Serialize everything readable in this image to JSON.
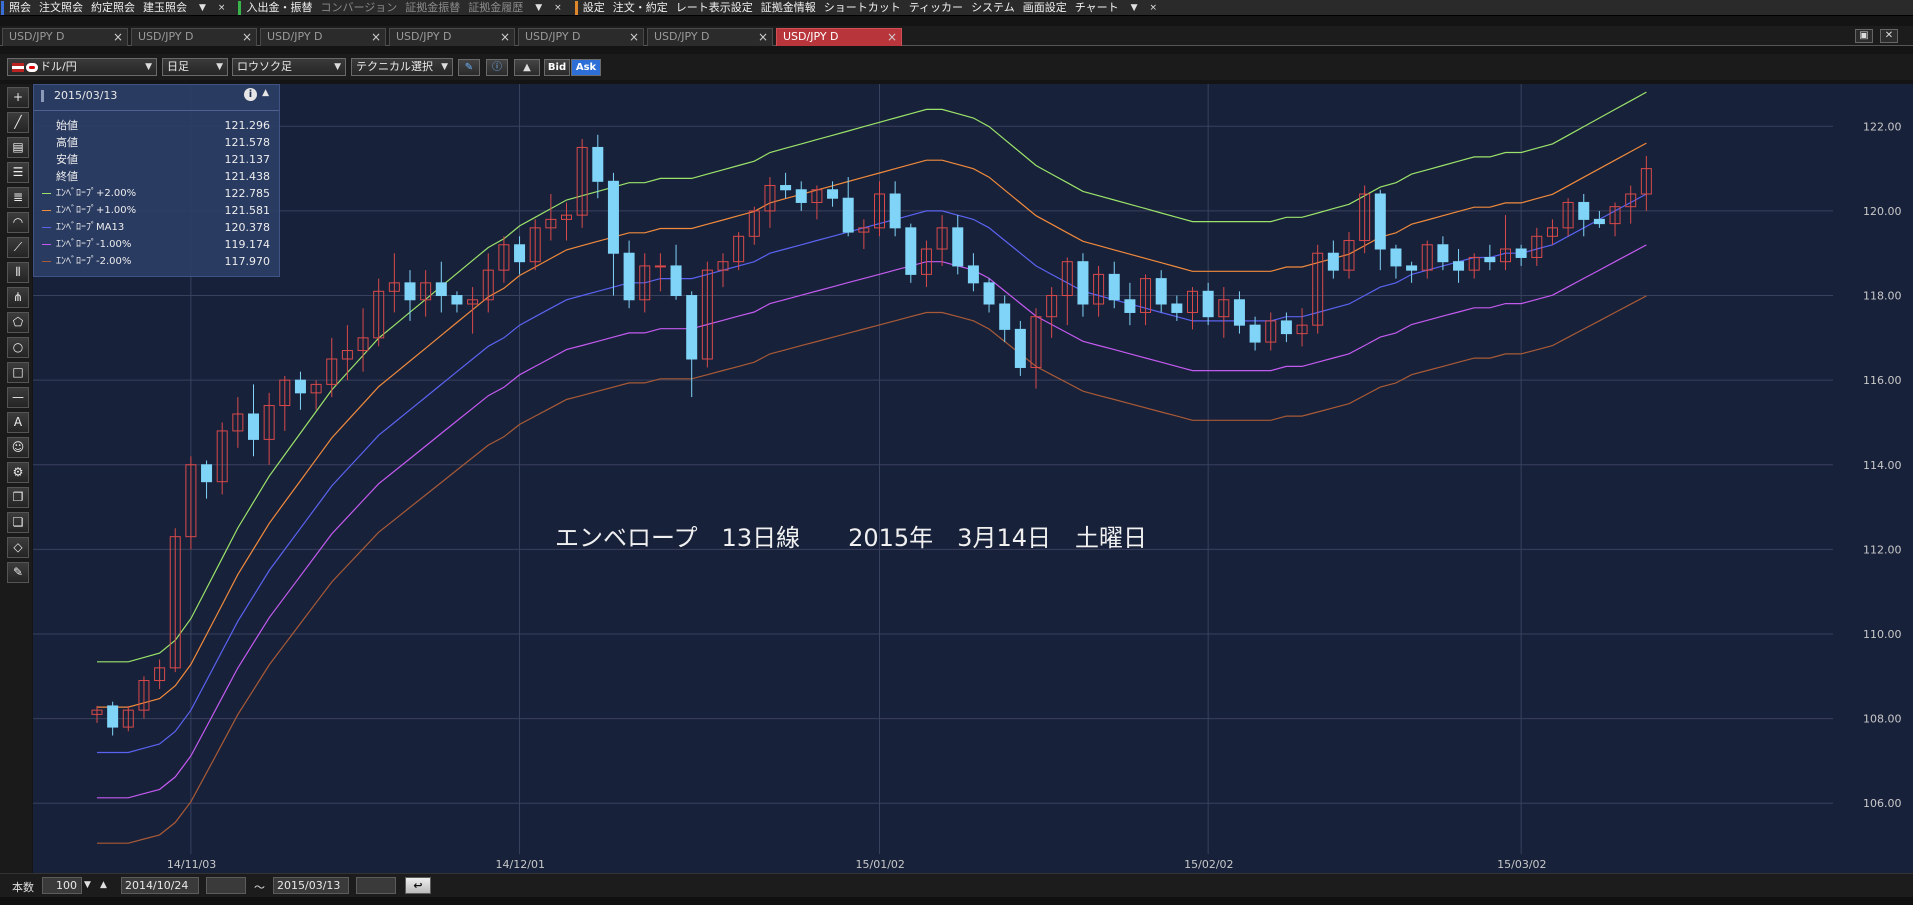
{
  "menubar": {
    "groups": [
      {
        "accent": "#3a6fd8",
        "items": [
          "照会",
          "注文照会",
          "約定照会",
          "建玉照会"
        ]
      },
      {
        "accent": "#38b44a",
        "items": [
          "入出金・振替",
          "コンバージョン",
          "証拠金振替",
          "証拠金履歴"
        ]
      },
      {
        "accent": "#e0862a",
        "items": [
          "設定",
          "注文・約定",
          "レート表示設定",
          "証拠金情報",
          "ショートカット",
          "ティッカー",
          "システム",
          "画面設定",
          "チャート"
        ]
      }
    ],
    "disabled_items": [
      "コンバージョン",
      "証拠金振替",
      "証拠金履歴"
    ],
    "dropdown_glyph": "▼",
    "close_glyph": "×"
  },
  "tabs": [
    {
      "label": "USD/JPY D",
      "active": false
    },
    {
      "label": "USD/JPY D",
      "active": false
    },
    {
      "label": "USD/JPY D",
      "active": false
    },
    {
      "label": "USD/JPY D",
      "active": false
    },
    {
      "label": "USD/JPY D",
      "active": false
    },
    {
      "label": "USD/JPY D",
      "active": false
    },
    {
      "label": "USD/JPY D",
      "active": true
    }
  ],
  "tab_close_glyph": "×",
  "window_controls": {
    "restore": "▣",
    "close": "✕"
  },
  "toolbar": {
    "currency_pair": "ドル/円",
    "timeframe": "日足",
    "chart_type": "ロウソク足",
    "technical_select": "テクニカル選択",
    "bid_label": "Bid",
    "ask_label": "Ask",
    "dropdown_arrow": "▼"
  },
  "info_panel": {
    "date": "2015/03/13",
    "info_glyph": "i",
    "collapse_glyph": "▲",
    "rows": [
      {
        "label": "始値",
        "value": "121.296",
        "color": ""
      },
      {
        "label": "高値",
        "value": "121.578",
        "color": ""
      },
      {
        "label": "安値",
        "value": "121.137",
        "color": ""
      },
      {
        "label": "終値",
        "value": "121.438",
        "color": ""
      },
      {
        "label": "ｴﾝﾍﾞﾛｰﾌﾟ+2.00%",
        "value": "122.785",
        "color": "#9be36a"
      },
      {
        "label": "ｴﾝﾍﾞﾛｰﾌﾟ+1.00%",
        "value": "121.581",
        "color": "#f08a3c"
      },
      {
        "label": "ｴﾝﾍﾞﾛｰﾌﾟMA13",
        "value": "120.378",
        "color": "#5a63f0"
      },
      {
        "label": "ｴﾝﾍﾞﾛｰﾌﾟ-1.00%",
        "value": "119.174",
        "color": "#c35af0"
      },
      {
        "label": "ｴﾝﾍﾞﾛｰﾌﾟ-2.00%",
        "value": "117.970",
        "color": "#a85a36"
      }
    ]
  },
  "chart_data": {
    "type": "line",
    "title": "エンベロープ　13日線　　2015年　3月14日　土曜日",
    "y_ticks": [
      106.0,
      108.0,
      110.0,
      112.0,
      114.0,
      116.0,
      118.0,
      120.0,
      122.0
    ],
    "ylim": [
      104.8,
      123.0
    ],
    "x_ticks": [
      "14/11/03",
      "14/12/01",
      "15/01/02",
      "15/02/02",
      "15/03/02"
    ],
    "x_tick_bar_index": [
      6,
      27,
      50,
      71,
      91
    ],
    "bar_count": 100,
    "candles_ohlc": [
      [
        108.1,
        108.3,
        107.9,
        108.2
      ],
      [
        108.3,
        108.4,
        107.6,
        107.8
      ],
      [
        107.8,
        108.3,
        107.7,
        108.2
      ],
      [
        108.2,
        109.0,
        108.0,
        108.9
      ],
      [
        108.9,
        109.4,
        108.7,
        109.2
      ],
      [
        109.2,
        112.5,
        109.1,
        112.3
      ],
      [
        112.3,
        114.2,
        112.0,
        114.0
      ],
      [
        114.0,
        114.1,
        113.2,
        113.6
      ],
      [
        113.6,
        115.0,
        113.3,
        114.8
      ],
      [
        114.8,
        115.6,
        114.4,
        115.2
      ],
      [
        115.2,
        115.9,
        114.2,
        114.6
      ],
      [
        114.6,
        115.7,
        114.0,
        115.4
      ],
      [
        115.4,
        116.1,
        114.8,
        116.0
      ],
      [
        116.0,
        116.2,
        115.3,
        115.7
      ],
      [
        115.7,
        116.0,
        115.3,
        115.9
      ],
      [
        115.9,
        117.0,
        115.6,
        116.5
      ],
      [
        116.5,
        117.3,
        116.0,
        116.7
      ],
      [
        116.7,
        117.7,
        116.2,
        117.0
      ],
      [
        117.0,
        118.4,
        116.8,
        118.1
      ],
      [
        118.1,
        119.0,
        117.6,
        118.3
      ],
      [
        118.3,
        118.6,
        117.4,
        117.9
      ],
      [
        117.9,
        118.6,
        117.5,
        118.3
      ],
      [
        118.3,
        118.8,
        117.6,
        118.0
      ],
      [
        118.0,
        118.1,
        117.6,
        117.8
      ],
      [
        117.8,
        118.2,
        117.1,
        117.9
      ],
      [
        117.9,
        119.0,
        117.6,
        118.6
      ],
      [
        118.6,
        119.4,
        118.3,
        119.2
      ],
      [
        119.2,
        119.4,
        118.5,
        118.8
      ],
      [
        118.8,
        119.8,
        118.6,
        119.6
      ],
      [
        119.6,
        120.4,
        119.3,
        119.8
      ],
      [
        119.8,
        120.2,
        119.3,
        119.9
      ],
      [
        119.9,
        121.7,
        119.6,
        121.5
      ],
      [
        121.5,
        121.8,
        120.3,
        120.7
      ],
      [
        120.7,
        120.9,
        118.0,
        119.0
      ],
      [
        119.0,
        119.3,
        117.7,
        117.9
      ],
      [
        117.9,
        119.0,
        117.6,
        118.7
      ],
      [
        118.7,
        119.0,
        118.1,
        118.7
      ],
      [
        118.7,
        119.2,
        117.9,
        118.0
      ],
      [
        118.0,
        118.1,
        115.6,
        116.5
      ],
      [
        116.5,
        118.8,
        116.3,
        118.6
      ],
      [
        118.6,
        119.0,
        118.2,
        118.8
      ],
      [
        118.8,
        119.5,
        118.6,
        119.4
      ],
      [
        119.4,
        120.1,
        119.2,
        120.0
      ],
      [
        120.0,
        120.8,
        119.6,
        120.6
      ],
      [
        120.6,
        120.9,
        120.3,
        120.5
      ],
      [
        120.5,
        120.7,
        120.0,
        120.2
      ],
      [
        120.2,
        120.6,
        119.8,
        120.5
      ],
      [
        120.5,
        120.7,
        120.1,
        120.3
      ],
      [
        120.3,
        120.8,
        119.4,
        119.5
      ],
      [
        119.5,
        119.8,
        119.1,
        119.6
      ],
      [
        119.6,
        120.7,
        119.4,
        120.4
      ],
      [
        120.4,
        120.7,
        119.4,
        119.6
      ],
      [
        119.6,
        119.7,
        118.3,
        118.5
      ],
      [
        118.5,
        119.3,
        118.2,
        119.1
      ],
      [
        119.1,
        119.9,
        118.7,
        119.6
      ],
      [
        119.6,
        119.9,
        118.5,
        118.7
      ],
      [
        118.7,
        119.0,
        118.1,
        118.3
      ],
      [
        118.3,
        118.4,
        117.6,
        117.8
      ],
      [
        117.8,
        118.0,
        116.9,
        117.2
      ],
      [
        117.2,
        117.4,
        116.1,
        116.3
      ],
      [
        116.3,
        117.7,
        115.8,
        117.5
      ],
      [
        117.5,
        118.2,
        117.0,
        118.0
      ],
      [
        118.0,
        118.9,
        117.3,
        118.8
      ],
      [
        118.8,
        119.0,
        117.5,
        117.8
      ],
      [
        117.8,
        118.7,
        117.5,
        118.5
      ],
      [
        118.5,
        118.8,
        117.7,
        117.9
      ],
      [
        117.9,
        118.3,
        117.3,
        117.6
      ],
      [
        117.6,
        118.5,
        117.3,
        118.4
      ],
      [
        118.4,
        118.6,
        117.6,
        117.8
      ],
      [
        117.8,
        118.0,
        117.4,
        117.6
      ],
      [
        117.6,
        118.2,
        117.2,
        118.1
      ],
      [
        118.1,
        118.3,
        117.3,
        117.5
      ],
      [
        117.5,
        118.2,
        117.0,
        117.9
      ],
      [
        117.9,
        118.1,
        117.1,
        117.3
      ],
      [
        117.3,
        117.5,
        116.7,
        116.9
      ],
      [
        116.9,
        117.6,
        116.7,
        117.4
      ],
      [
        117.4,
        117.6,
        116.9,
        117.1
      ],
      [
        117.1,
        117.7,
        116.8,
        117.3
      ],
      [
        117.3,
        119.2,
        117.1,
        119.0
      ],
      [
        119.0,
        119.3,
        118.4,
        118.6
      ],
      [
        118.6,
        119.5,
        118.4,
        119.3
      ],
      [
        119.3,
        120.6,
        119.0,
        120.4
      ],
      [
        120.4,
        120.5,
        118.6,
        119.1
      ],
      [
        119.1,
        119.2,
        118.4,
        118.7
      ],
      [
        118.7,
        118.8,
        118.3,
        118.6
      ],
      [
        118.6,
        119.3,
        118.4,
        119.2
      ],
      [
        119.2,
        119.4,
        118.6,
        118.8
      ],
      [
        118.8,
        119.1,
        118.3,
        118.6
      ],
      [
        118.6,
        119.0,
        118.4,
        118.9
      ],
      [
        118.9,
        119.2,
        118.6,
        118.8
      ],
      [
        118.8,
        119.9,
        118.6,
        119.1
      ],
      [
        119.1,
        119.2,
        118.7,
        118.9
      ],
      [
        118.9,
        119.6,
        118.7,
        119.4
      ],
      [
        119.4,
        119.8,
        119.2,
        119.6
      ],
      [
        119.6,
        120.3,
        119.4,
        120.2
      ],
      [
        120.2,
        120.4,
        119.4,
        119.8
      ],
      [
        119.8,
        120.0,
        119.6,
        119.7
      ],
      [
        119.7,
        120.2,
        119.4,
        120.1
      ],
      [
        120.1,
        120.6,
        119.7,
        120.4
      ],
      [
        120.4,
        121.3,
        120.0,
        121.0
      ]
    ],
    "series": [
      {
        "name": "ｴﾝﾍﾞﾛｰﾌﾟ+2.00%",
        "color": "#9be36a"
      },
      {
        "name": "ｴﾝﾍﾞﾛｰﾌﾟ+1.00%",
        "color": "#f08a3c"
      },
      {
        "name": "ｴﾝﾍﾞﾛｰﾌﾟMA13",
        "color": "#5a63f0"
      },
      {
        "name": "ｴﾝﾍﾞﾛｰﾌﾟ-1.00%",
        "color": "#c35af0"
      },
      {
        "name": "ｴﾝﾍﾞﾛｰﾌﾟ-2.00%",
        "color": "#a85a36"
      }
    ],
    "ma13_values": [
      107.2,
      107.2,
      107.2,
      107.3,
      107.4,
      107.7,
      108.2,
      108.9,
      109.6,
      110.3,
      110.9,
      111.5,
      112.0,
      112.5,
      113.0,
      113.5,
      113.9,
      114.3,
      114.7,
      115.0,
      115.3,
      115.6,
      115.9,
      116.2,
      116.5,
      116.8,
      117.0,
      117.3,
      117.5,
      117.7,
      117.9,
      118.0,
      118.1,
      118.2,
      118.3,
      118.3,
      118.4,
      118.4,
      118.4,
      118.5,
      118.6,
      118.7,
      118.8,
      119.0,
      119.1,
      119.2,
      119.3,
      119.4,
      119.5,
      119.6,
      119.7,
      119.8,
      119.9,
      120.0,
      120.0,
      119.9,
      119.8,
      119.6,
      119.3,
      119.0,
      118.7,
      118.5,
      118.3,
      118.1,
      118.0,
      117.9,
      117.8,
      117.7,
      117.6,
      117.5,
      117.4,
      117.4,
      117.4,
      117.4,
      117.4,
      117.4,
      117.5,
      117.5,
      117.6,
      117.7,
      117.8,
      118.0,
      118.2,
      118.3,
      118.5,
      118.6,
      118.7,
      118.8,
      118.9,
      118.9,
      119.0,
      119.0,
      119.1,
      119.2,
      119.4,
      119.6,
      119.8,
      120.0,
      120.2,
      120.4
    ],
    "envelope_pct": [
      2.0,
      1.0,
      0.0,
      -1.0,
      -2.0
    ],
    "grid": true,
    "up_color": "#d84a4a",
    "down_color": "#7fd4f7"
  },
  "bottombar": {
    "count_label": "本数",
    "count_value": "100",
    "start_date": "2014/10/24",
    "tilde": "～",
    "end_date": "2015/03/13",
    "return_glyph": "↩",
    "spin_down": "▼",
    "spin_up": "▲"
  },
  "tools": [
    {
      "name": "crosshair-tool-icon",
      "glyph": "+"
    },
    {
      "name": "trendline-tool-icon",
      "glyph": "╱"
    },
    {
      "name": "ruler-tool-icon",
      "glyph": "▤"
    },
    {
      "name": "horizontal-lines-tool-icon",
      "glyph": "☰"
    },
    {
      "name": "fibonacci-tool-icon",
      "glyph": "≣"
    },
    {
      "name": "arc-tool-icon",
      "glyph": "◠"
    },
    {
      "name": "fan-tool-icon",
      "glyph": "⟋"
    },
    {
      "name": "vertical-lines-tool-icon",
      "glyph": "⦀"
    },
    {
      "name": "pitchfork-tool-icon",
      "glyph": "⋔"
    },
    {
      "name": "pentagon-tool-icon",
      "glyph": "⬠"
    },
    {
      "name": "circle-tool-icon",
      "glyph": "○"
    },
    {
      "name": "rectangle-tool-icon",
      "glyph": "□"
    },
    {
      "name": "hline-tool-icon",
      "glyph": "—"
    },
    {
      "name": "text-tool-icon",
      "glyph": "A"
    },
    {
      "name": "stamp-tool-icon",
      "glyph": "☺"
    },
    {
      "name": "settings-tool-icon",
      "glyph": "⚙"
    },
    {
      "name": "copy-tool-icon",
      "glyph": "❐"
    },
    {
      "name": "paste-tool-icon",
      "glyph": "❏"
    },
    {
      "name": "eraser-tool-icon",
      "glyph": "◇"
    },
    {
      "name": "eraser-all-tool-icon",
      "glyph": "✎"
    }
  ]
}
